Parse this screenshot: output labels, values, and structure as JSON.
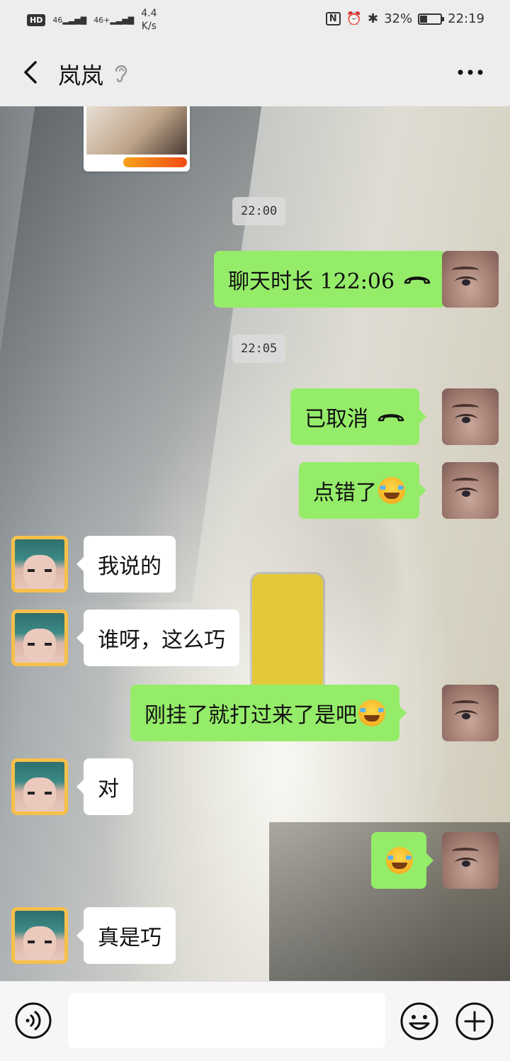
{
  "status_bar": {
    "network_badge": "HD",
    "signal_1": "46",
    "signal_2": "46+",
    "speed_value": "4.4",
    "speed_unit": "K/s",
    "battery_text": "32%",
    "battery_level": 0.32,
    "time": "22:19",
    "icons": [
      "nfc-icon",
      "alarm-icon",
      "bluetooth-icon",
      "battery-icon"
    ]
  },
  "header": {
    "title": "岚岚",
    "icons": [
      "back-icon",
      "ear-icon",
      "more-icon"
    ]
  },
  "chat": {
    "timestamps": [
      "22:00",
      "22:05"
    ],
    "messages": [
      {
        "from": "me",
        "text": "聊天时长 122:06",
        "icon": "hangup-icon"
      },
      {
        "from": "me",
        "text": "已取消",
        "icon": "hangup-icon"
      },
      {
        "from": "me",
        "text": "点错了",
        "icon": "face-palm-emoji"
      },
      {
        "from": "other",
        "text": "我说的"
      },
      {
        "from": "other",
        "text": "谁呀，这么巧"
      },
      {
        "from": "me",
        "text": "刚挂了就打过来了是吧",
        "icon": "laugh-tears-emoji"
      },
      {
        "from": "other",
        "text": "对"
      },
      {
        "from": "me",
        "text": "",
        "icon": "laugh-tears-emoji"
      },
      {
        "from": "other",
        "text": "真是巧"
      }
    ]
  },
  "input_bar": {
    "value": "",
    "icons": [
      "voice-icon",
      "emoji-icon",
      "plus-icon"
    ]
  },
  "colors": {
    "outgoing_bubble": "#95ec69",
    "incoming_bubble": "#ffffff",
    "other_avatar_border": "#f6c04a",
    "header_bg": "#ededed"
  }
}
